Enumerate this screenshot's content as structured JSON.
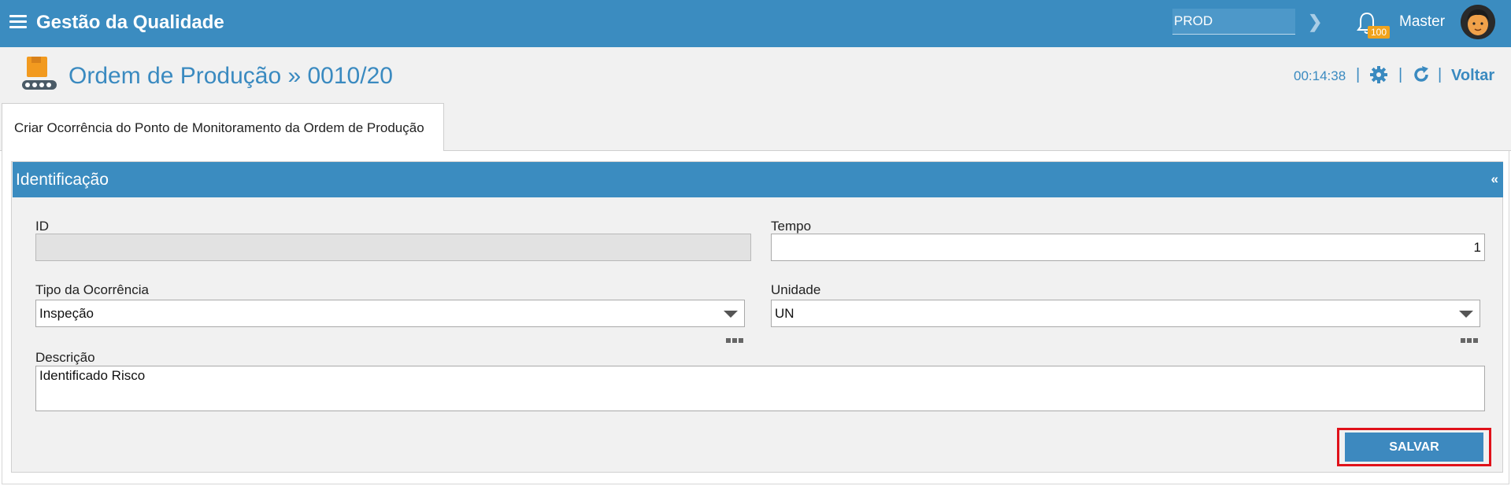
{
  "topbar": {
    "app_title": "Gestão da Qualidade",
    "environment_value": "PROD",
    "notification_count": "100",
    "user_name": "Master"
  },
  "page": {
    "title": "Ordem de Produção » 0010/20",
    "timer": "00:14:38",
    "separator": "|",
    "back_label": "Voltar"
  },
  "tabs": [
    {
      "label": "Criar Ocorrência do Ponto de Monitoramento da Ordem de Produção",
      "active": true
    }
  ],
  "section": {
    "title": "Identificação",
    "collapse_label": "«"
  },
  "form": {
    "id_label": "ID",
    "id_value": "",
    "tempo_label": "Tempo",
    "tempo_value": "1",
    "tipo_label": "Tipo da Ocorrência",
    "tipo_value": "Inspeção",
    "unidade_label": "Unidade",
    "unidade_value": "UN",
    "descricao_label": "Descrição",
    "descricao_value": "Identificado Risco",
    "save_label": "SALVAR"
  },
  "colors": {
    "primary": "#3b8cc0",
    "badge": "#f0a31c",
    "highlight": "#e0121a"
  }
}
